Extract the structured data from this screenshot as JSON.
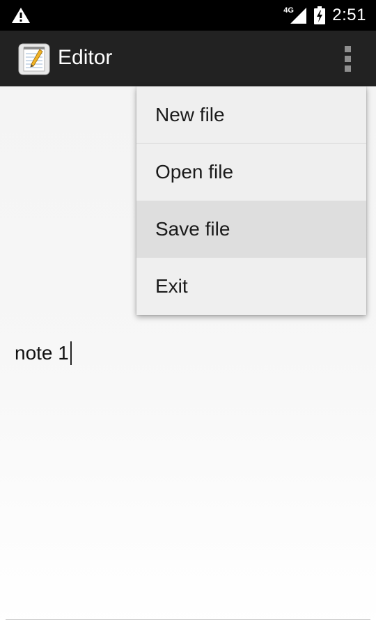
{
  "status_bar": {
    "network_label": "4G",
    "clock": "2:51",
    "icons": [
      "warning-icon",
      "signal-icon",
      "battery-charging-icon"
    ]
  },
  "action_bar": {
    "title": "Editor",
    "app_icon": "notepad-icon",
    "overflow_icon": "overflow-menu-icon"
  },
  "editor": {
    "text": "note 1"
  },
  "menu": {
    "items": [
      {
        "label": "New file"
      },
      {
        "label": "Open file"
      },
      {
        "label": "Save file"
      },
      {
        "label": "Exit"
      }
    ],
    "pressed_item": "Save file"
  }
}
